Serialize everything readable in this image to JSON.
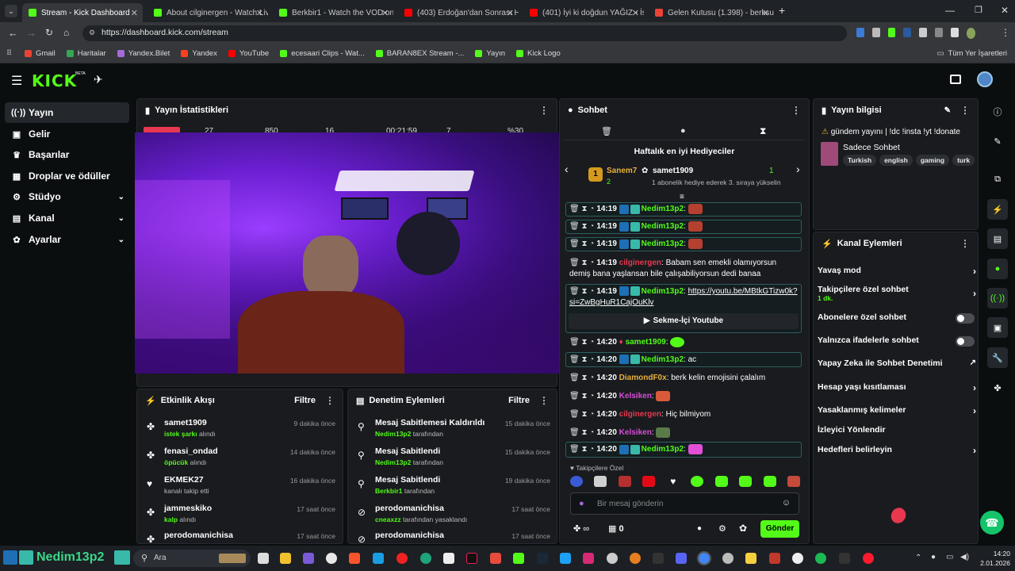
{
  "browser": {
    "tabs": [
      {
        "label": "Stream - Kick Dashboard",
        "color": "#53fc18"
      },
      {
        "label": "About cilginergen - Watch Live",
        "color": "#53fc18"
      },
      {
        "label": "Berkbir1 - Watch the VOD on K",
        "color": "#53fc18"
      },
      {
        "label": "(403) Erdoğan'dan Sonrası Hes",
        "color": "#ff0000"
      },
      {
        "label": "(401) İyi ki doğdun YAĞIZ - İsm",
        "color": "#ff0000"
      },
      {
        "label": "Gelen Kutusu (1.398) - berksua",
        "color": "#ea4335"
      }
    ],
    "url": "https://dashboard.kick.com/stream",
    "bookmarks": [
      "Gmail",
      "Haritalar",
      "Yandex.Bilet",
      "Yandex",
      "YouTube",
      "ecesaari Clips - Wat...",
      "BARAN8EX Stream -...",
      "Yayın",
      "Kick Logo"
    ],
    "all_bookmarks": "Tüm Yer İşaretleri"
  },
  "kick": {
    "logo": "KICK",
    "beta": "BETA"
  },
  "sidebar": {
    "items": [
      {
        "label": "Yayın",
        "icon": "broadcast-icon"
      },
      {
        "label": "Gelir",
        "icon": "money-icon"
      },
      {
        "label": "Başarılar",
        "icon": "trophy-icon"
      },
      {
        "label": "Droplar ve ödüller",
        "icon": "gift-icon"
      },
      {
        "label": "Stüdyo",
        "icon": "gear-icon"
      },
      {
        "label": "Kanal",
        "icon": "channel-icon"
      },
      {
        "label": "Ayarlar",
        "icon": "settings-icon"
      }
    ]
  },
  "stats": {
    "title": "Yayın İstatistikleri",
    "values": [
      "27",
      "850",
      "16",
      "00:21:59",
      "7",
      "%30"
    ]
  },
  "activity": {
    "title": "Etkinlik Akışı",
    "filter": "Filtre",
    "items": [
      {
        "user": "samet1909",
        "action": "istek şarkı",
        "suffix": "alındı",
        "time": "9 dakika önce"
      },
      {
        "user": "fenasi_ondad",
        "action": "öpücük",
        "suffix": "alındı",
        "time": "14 dakika önce"
      },
      {
        "user": "EKMEK27",
        "action": "",
        "suffix": "kanalı takip etti",
        "time": "16 dakika önce"
      },
      {
        "user": "jammeskiko",
        "action": "kalp",
        "suffix": "alındı",
        "time": "17 saat önce"
      },
      {
        "user": "perodomanichisa",
        "action": "",
        "suffix": "",
        "time": "17 saat önce"
      }
    ]
  },
  "moderation": {
    "title": "Denetim Eylemleri",
    "filter": "Filtre",
    "items": [
      {
        "title": "Mesaj Sabitlemesi Kaldırıldı",
        "by": "Nedim13p2",
        "suffix": "tarafından",
        "time": "15 dakika önce"
      },
      {
        "title": "Mesaj Sabitlendi",
        "by": "Nedim13p2",
        "suffix": "tarafından",
        "time": "15 dakika önce"
      },
      {
        "title": "Mesaj Sabitlendi",
        "by": "Berkbir1",
        "suffix": "tarafından",
        "time": "19 dakika önce"
      },
      {
        "title": "perodomanichisa",
        "by": "cneaxzz",
        "suffix": "tarafından yasaklandı",
        "time": "17 saat önce"
      },
      {
        "title": "perodomanichisa",
        "by": "",
        "suffix": "",
        "time": "17 saat önce"
      }
    ]
  },
  "chat": {
    "title": "Sohbet",
    "gifters_title": "Haftalık en iyi Hediyeciler",
    "top1": {
      "name": "Sanem7",
      "count": "2"
    },
    "top2": {
      "name": "samet1909",
      "count": "1"
    },
    "gift_note": "1 abonelik hediye ederek 3. sıraya yükselin",
    "messages": [
      {
        "time": "14:19",
        "user": "Nedim13p2",
        "text": ""
      },
      {
        "time": "14:19",
        "user": "Nedim13p2",
        "text": ""
      },
      {
        "time": "14:19",
        "user": "Nedim13p2",
        "text": ""
      },
      {
        "time": "14:19",
        "user": "cilginergen",
        "text": "Babam sen emekli olamıyorsun demiş bana yaşlansan bile çalışabiliyorsun dedi banaa"
      },
      {
        "time": "14:19",
        "user": "Nedim13p2",
        "text": "https://youtu.be/MBtkGTizw0k?si=ZwBgHuR1CajOuKlv"
      },
      {
        "time": "14:20",
        "user": "samet1909",
        "text": ""
      },
      {
        "time": "14:20",
        "user": "Nedim13p2",
        "text": "ac"
      },
      {
        "time": "14:20",
        "user": "DiamondF0x",
        "text": "berk kelin emojisini çalalım"
      },
      {
        "time": "14:20",
        "user": "Kelsiken",
        "text": ""
      },
      {
        "time": "14:20",
        "user": "cilginergen",
        "text": "Hiç bilmiyom"
      },
      {
        "time": "14:20",
        "user": "Kelsiken",
        "text": ""
      },
      {
        "time": "14:20",
        "user": "Nedim13p2",
        "text": ""
      }
    ],
    "youtube_btn": "Sekme-İçi Youtube",
    "followers_only": "Takipçilere Özel",
    "placeholder": "Bir mesaj gönderin",
    "viewer_count": "0",
    "send": "Gönder"
  },
  "info": {
    "title": "Yayın bilgisi",
    "stream_title": "gündem yayını | !dc !insta !yt !donate",
    "category": "Sadece Sohbet",
    "tags": [
      "Turkish",
      "english",
      "gaming",
      "turk"
    ]
  },
  "channel_actions": {
    "title": "Kanal Eylemleri",
    "rows": [
      {
        "label": "Yavaş mod",
        "type": "arrow"
      },
      {
        "label": "Takipçilere özel sohbet",
        "sub": "1 dk.",
        "type": "arrow"
      },
      {
        "label": "Abonelere özel sohbet",
        "type": "toggle"
      },
      {
        "label": "Yalnızca ifadelerle sohbet",
        "type": "toggle"
      },
      {
        "label": "Yapay Zeka ile Sohbet Denetimi",
        "type": "ext"
      },
      {
        "label": "Hesap yaşı kısıtlaması",
        "type": "arrow"
      },
      {
        "label": "Yasaklanmış kelimeler",
        "type": "arrow"
      },
      {
        "label": "İzleyici Yönlendir",
        "type": "none"
      },
      {
        "label": "Hedefleri belirleyin",
        "type": "arrow"
      }
    ]
  },
  "taskbar": {
    "user": "Nedim13p2",
    "search": "Ara",
    "time": "14:20",
    "date": "2.01.2026"
  }
}
